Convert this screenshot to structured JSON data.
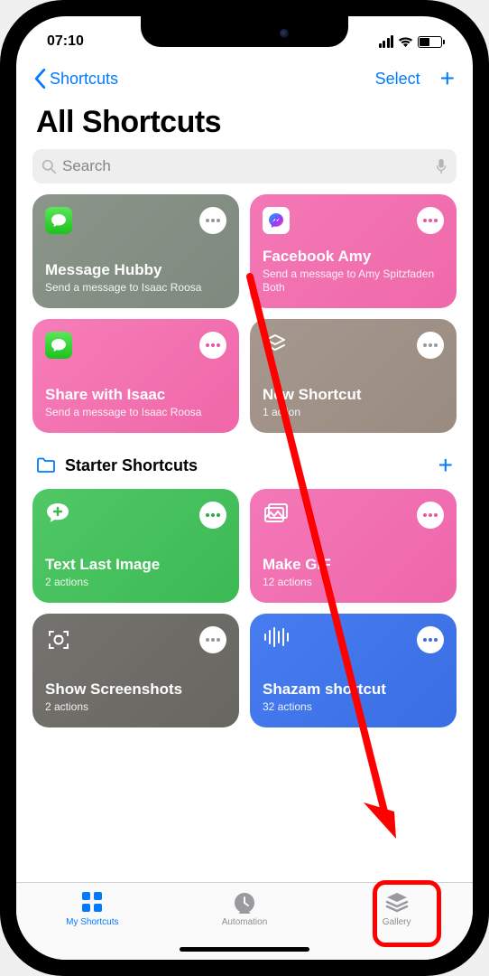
{
  "status": {
    "time": "07:10"
  },
  "nav": {
    "back_label": "Shortcuts",
    "select_label": "Select"
  },
  "title": "All Shortcuts",
  "search": {
    "placeholder": "Search"
  },
  "cards": [
    {
      "title": "Message Hubby",
      "sub": "Send a message to Isaac Roosa"
    },
    {
      "title": "Facebook Amy",
      "sub": "Send a message to Amy Spitzfaden Both"
    },
    {
      "title": "Share with Isaac",
      "sub": "Send a message to Isaac Roosa"
    },
    {
      "title": "New Shortcut",
      "sub": "1 action"
    }
  ],
  "section": {
    "title": "Starter Shortcuts"
  },
  "cards2": [
    {
      "title": "Text Last Image",
      "sub": "2 actions"
    },
    {
      "title": "Make GIF",
      "sub": "12 actions"
    },
    {
      "title": "Show Screenshots",
      "sub": "2 actions"
    },
    {
      "title": "Shazam shortcut",
      "sub": "32 actions"
    }
  ],
  "tabs": {
    "shortcuts": "My Shortcuts",
    "automation": "Automation",
    "gallery": "Gallery"
  }
}
